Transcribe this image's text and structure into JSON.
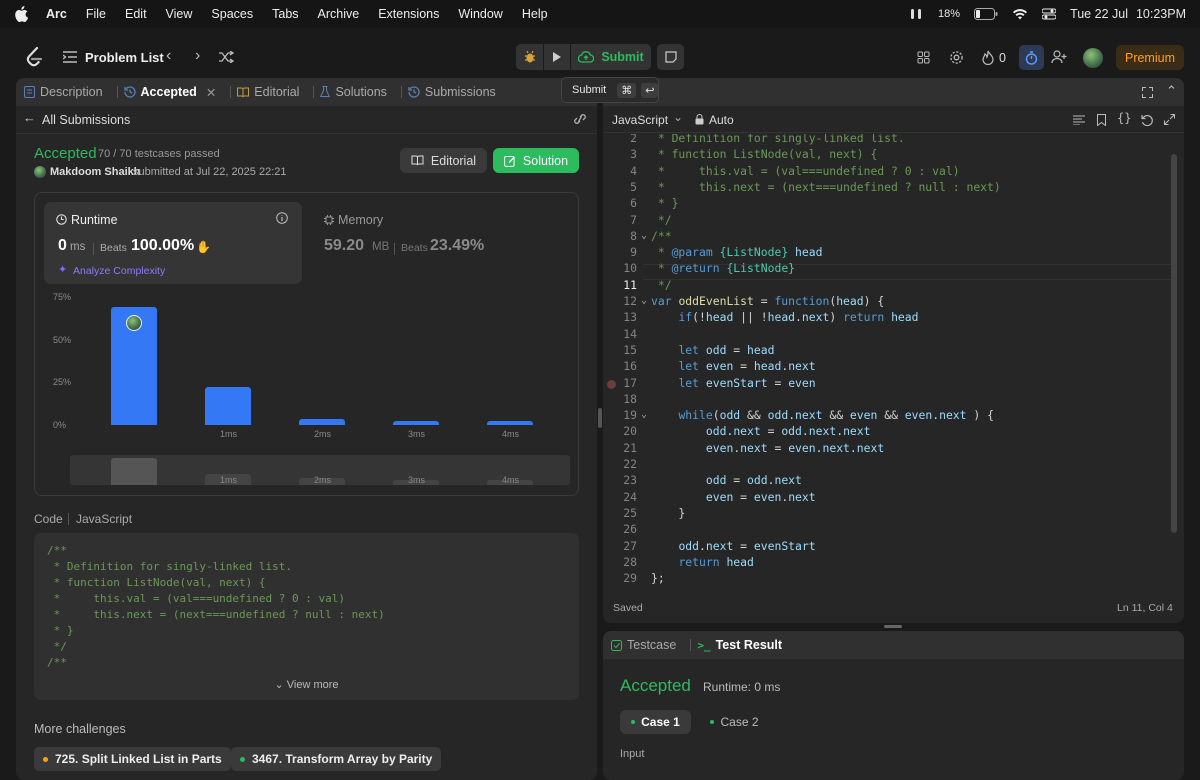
{
  "menubar": {
    "app": "Arc",
    "items": [
      "File",
      "Edit",
      "View",
      "Spaces",
      "Tabs",
      "Archive",
      "Extensions",
      "Window",
      "Help"
    ],
    "battery": "18%",
    "date": "Tue 22 Jul",
    "time": "10:23PM"
  },
  "toolbar": {
    "problem_list": "Problem List",
    "submit_label": "Submit",
    "streak_count": "0",
    "premium_label": "Premium",
    "tooltip_label": "Submit",
    "tooltip_keys": [
      "⌘",
      "↩"
    ]
  },
  "left_tabs": [
    {
      "label": "Description"
    },
    {
      "label": "Accepted"
    },
    {
      "label": "Editorial"
    },
    {
      "label": "Solutions"
    },
    {
      "label": "Submissions"
    }
  ],
  "submission": {
    "back_label": "All Submissions",
    "status": "Accepted",
    "testcases": "70 / 70 testcases passed",
    "user": "Makdoom Shaikh",
    "submitted_text": "submitted at Jul 22, 2025 22:21",
    "editorial_btn": "Editorial",
    "solution_btn": "Solution"
  },
  "runtime": {
    "title": "Runtime",
    "value": "0",
    "unit": "ms",
    "beats_label": "Beats",
    "beats_value": "100.00%",
    "analyze_label": "Analyze Complexity"
  },
  "memory": {
    "title": "Memory",
    "value": "59.20",
    "unit": "MB",
    "beats_label": "Beats",
    "beats_value": "23.49%"
  },
  "chart_data": {
    "type": "bar",
    "ytick_labels": [
      "75%",
      "50%",
      "25%",
      "0%"
    ],
    "yticks": [
      75,
      50,
      25,
      0
    ],
    "ylim": [
      0,
      75
    ],
    "categories": [
      "",
      "1ms",
      "2ms",
      "3ms",
      "4ms"
    ],
    "values": [
      69,
      22,
      3.5,
      2.5,
      2.5
    ],
    "mini_values": [
      15,
      6,
      4,
      3,
      3
    ],
    "color": "#3478f6"
  },
  "code_section": {
    "label": "Code",
    "language": "JavaScript",
    "lines": [
      "/**",
      " * Definition for singly-linked list.",
      " * function ListNode(val, next) {",
      " *     this.val = (val===undefined ? 0 : val)",
      " *     this.next = (next===undefined ? null : next)",
      " * }",
      " */",
      "/**"
    ],
    "view_more": "View more"
  },
  "more_challenges": {
    "title": "More challenges",
    "items": [
      {
        "label": "725. Split Linked List in Parts",
        "color": "#ffa116"
      },
      {
        "label": "3467. Transform Array by Parity",
        "color": "#2cbb5d"
      }
    ]
  },
  "editor": {
    "language": "JavaScript",
    "mode": "Auto",
    "saved": "Saved",
    "cursor": "Ln 11, Col 4",
    "line_numbers": [
      "2",
      "3",
      "4",
      "5",
      "6",
      "7",
      "8",
      "9",
      "10",
      "11",
      "12",
      "13",
      "14",
      "15",
      "16",
      "17",
      "18",
      "19",
      "20",
      "21",
      "22",
      "23",
      "24",
      "25",
      "26",
      "27",
      "28",
      "29"
    ]
  },
  "bottom": {
    "testcase_tab": "Testcase",
    "result_tab": "Test Result",
    "status": "Accepted",
    "runtime": "Runtime: 0 ms",
    "cases": [
      "Case 1",
      "Case 2"
    ],
    "input_label": "Input"
  },
  "colors": {
    "accepted": "#2cbb5d",
    "accent_blue": "#3478f6",
    "premium": "#ffa116"
  }
}
